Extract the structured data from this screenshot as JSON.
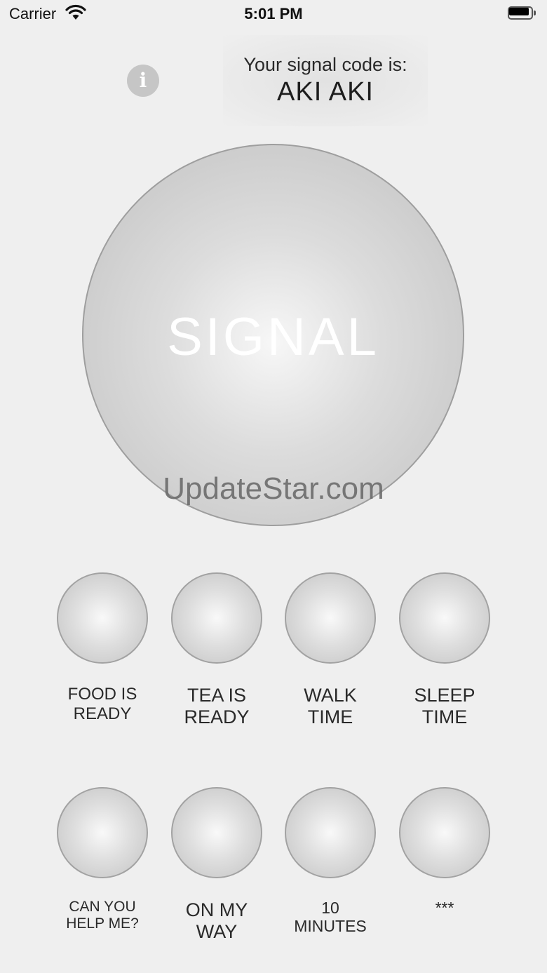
{
  "status_bar": {
    "carrier": "Carrier",
    "time": "5:01 PM"
  },
  "header": {
    "info_glyph": "i",
    "code_label": "Your signal code is:",
    "code_value": "AKI AKI"
  },
  "signal": {
    "label": "SIGNAL"
  },
  "watermark": "UpdateStar.com",
  "quick_signals": [
    {
      "line1": "FOOD IS",
      "line2": "READY"
    },
    {
      "line1": "TEA IS",
      "line2": "READY"
    },
    {
      "line1": "WALK",
      "line2": "TIME"
    },
    {
      "line1": "SLEEP",
      "line2": "TIME"
    },
    {
      "line1": "CAN YOU",
      "line2": "HELP ME?"
    },
    {
      "line1": "ON MY",
      "line2": "WAY"
    },
    {
      "line1": "10",
      "line2": "MINUTES"
    },
    {
      "line1": "***",
      "line2": ""
    }
  ],
  "colors": {
    "background": "#efefef",
    "button_border": "#a2a2a2",
    "signal_text": "#ffffff"
  },
  "icons": {
    "wifi": "wifi-icon",
    "battery": "battery-icon",
    "info": "info-icon"
  }
}
